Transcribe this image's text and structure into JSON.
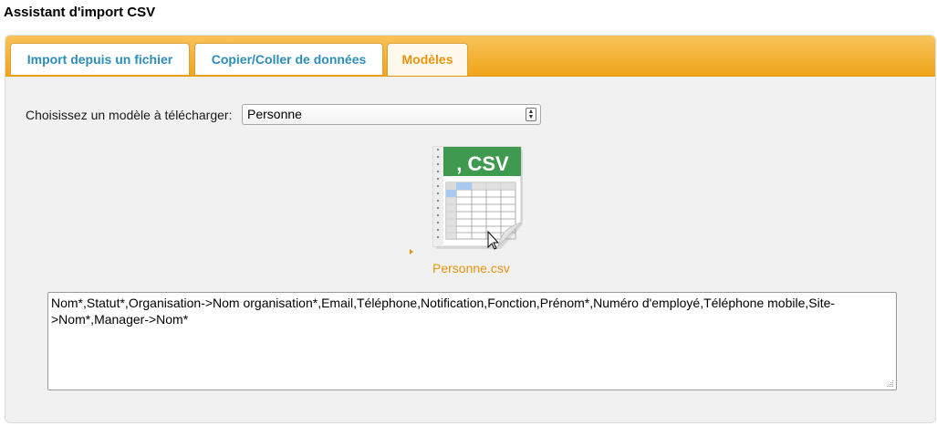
{
  "page": {
    "title": "Assistant d'import CSV"
  },
  "tabs": [
    {
      "label": "Import depuis un fichier",
      "active": false
    },
    {
      "label": "Copier/Coller de données",
      "active": false
    },
    {
      "label": "Modèles",
      "active": true
    }
  ],
  "template_chooser": {
    "label": "Choisissez un modèle à télécharger:",
    "selected": "Personne"
  },
  "file": {
    "icon": "csv-file-icon",
    "icon_text": ", CSV",
    "name": "Personne.csv"
  },
  "textarea": {
    "value": "Nom*,Statut*,Organisation->Nom organisation*,Email,Téléphone,Notification,Fonction,Prénom*,Numéro d'employé,Téléphone mobile,Site->Nom*,Manager->Nom*"
  },
  "colors": {
    "accent": "#f0a51a",
    "tab_text": "#2d8cb8",
    "active_tab_text": "#e8930f",
    "csv_green": "#3f9a4f"
  }
}
